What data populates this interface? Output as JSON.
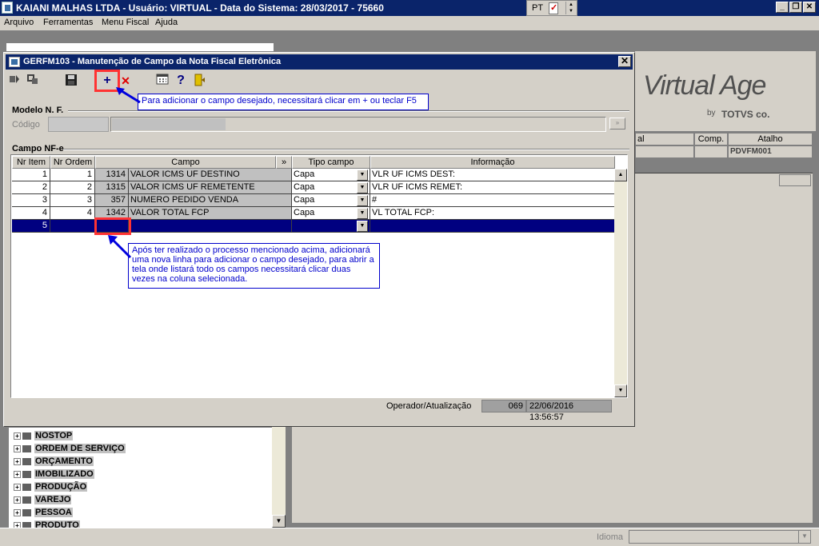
{
  "app": {
    "title": "KAIANI MALHAS LTDA - Usuário: VIRTUAL - Data do Sistema: 28/03/2017 - 75660",
    "language": "PT",
    "minimize": "_",
    "restore": "❐",
    "close": "✕"
  },
  "menu": {
    "arquivo": "Arquivo",
    "ferramentas": "Ferramentas",
    "menu_fiscal": "Menu Fiscal",
    "ajuda": "Ajuda"
  },
  "background": {
    "logo": "Virtual Age",
    "logo_by": "by",
    "logo_totvs": "TOTVS co.",
    "header_al": "al",
    "header_comp": "Comp.",
    "header_atalho": "Atalho",
    "atalho_value": "PDVFM001"
  },
  "tree": {
    "items": [
      "NOSTOP",
      "ORDEM DE SERVIÇO",
      "ORÇAMENTO",
      "IMOBILIZADO",
      "PRODUÇÃO",
      "VAREJO",
      "PESSOA",
      "PRODUTO"
    ]
  },
  "statusbar": {
    "idioma": "Idioma"
  },
  "dialog": {
    "title": "GERFM103 - Manutenção de Campo da Nota Fiscal Eletrônica",
    "close": "✕",
    "toolbar": {
      "add": "+",
      "delete": "✕",
      "help": "?"
    },
    "callout1": "Para adicionar o campo desejado, necessitará clicar em + ou teclar F5",
    "callout2": "Após ter realizado o processo mencionado acima, adicionará uma nova linha para adicionar o campo desejado, para abrir a tela onde listará todo os campos necessitará clicar duas vezes na coluna selecionada.",
    "modelo": {
      "title": "Modelo N. F.",
      "codigo_label": "Código",
      "lookup": "»"
    },
    "campo_nfe": {
      "title": "Campo NF-e",
      "headers": {
        "nr_item": "Nr Item",
        "nr_ordem": "Nr Ordem",
        "campo": "Campo",
        "more": "»",
        "tipo_campo": "Tipo campo",
        "informacao": "Informação"
      },
      "rows": [
        {
          "item": "1",
          "ordem": "1",
          "code": "1314",
          "campo": "VALOR ICMS UF DESTINO",
          "tipo": "Capa",
          "info": "VLR UF ICMS DEST:"
        },
        {
          "item": "2",
          "ordem": "2",
          "code": "1315",
          "campo": "VALOR ICMS UF REMETENTE",
          "tipo": "Capa",
          "info": "VLR UF ICMS REMET:"
        },
        {
          "item": "3",
          "ordem": "3",
          "code": "357",
          "campo": "NUMERO PEDIDO VENDA",
          "tipo": "Capa",
          "info": "#"
        },
        {
          "item": "4",
          "ordem": "4",
          "code": "1342",
          "campo": "VALOR TOTAL FCP",
          "tipo": "Capa",
          "info": "VL TOTAL FCP:"
        },
        {
          "item": "5",
          "ordem": "",
          "code": "",
          "campo": "",
          "tipo": "",
          "info": ""
        }
      ]
    },
    "operador": {
      "label": "Operador/Atualização",
      "code": "069",
      "datetime": "22/06/2016 13:56:57"
    }
  }
}
